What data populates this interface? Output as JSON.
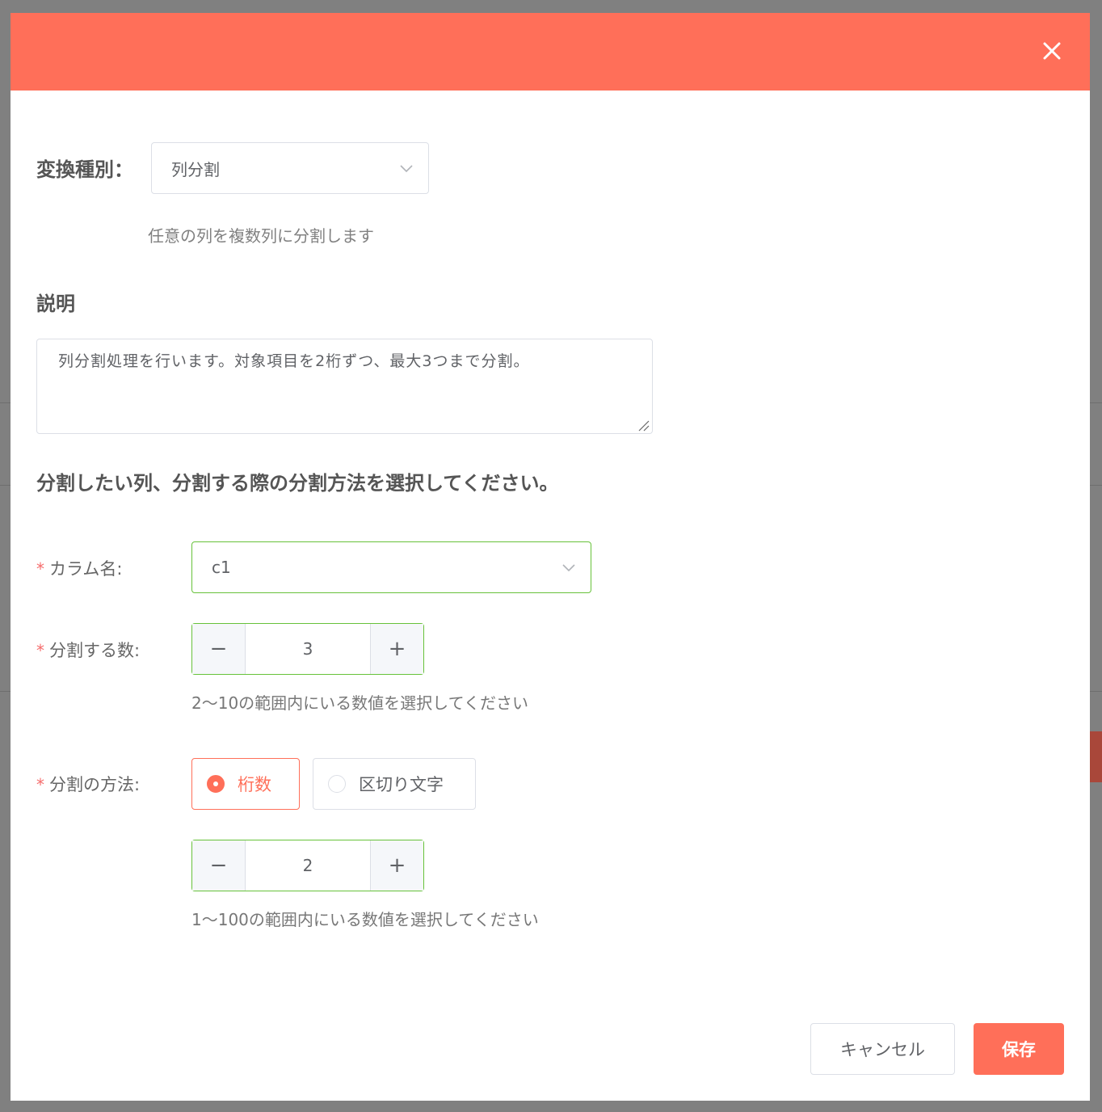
{
  "dialog": {
    "header_color": "#ff6f59",
    "close_icon": "close-icon"
  },
  "conversion_type": {
    "label": "変換種別：",
    "selected": "列分割",
    "description": "任意の列を複数列に分割します"
  },
  "explanation": {
    "label": "説明",
    "value": "列分割処理を行います。対象項目を2桁ずつ、最大3つまで分割。"
  },
  "instruction": "分割したい列、分割する際の分割方法を選択してください。",
  "form": {
    "required_mark": "*",
    "column_name": {
      "label": "カラム名:",
      "selected": "c1"
    },
    "split_count": {
      "label": "分割する数:",
      "value": "3",
      "minus": "−",
      "plus": "+",
      "hint": "2〜10の範囲内にいる数値を選択してください"
    },
    "split_method": {
      "label": "分割の方法:",
      "options": [
        "桁数",
        "区切り文字"
      ],
      "selected_index": 0,
      "digits_value": "2",
      "minus": "−",
      "plus": "+",
      "hint": "1〜100の範囲内にいる数値を選択してください"
    }
  },
  "footer": {
    "cancel_label": "キャンセル",
    "save_label": "保存"
  }
}
